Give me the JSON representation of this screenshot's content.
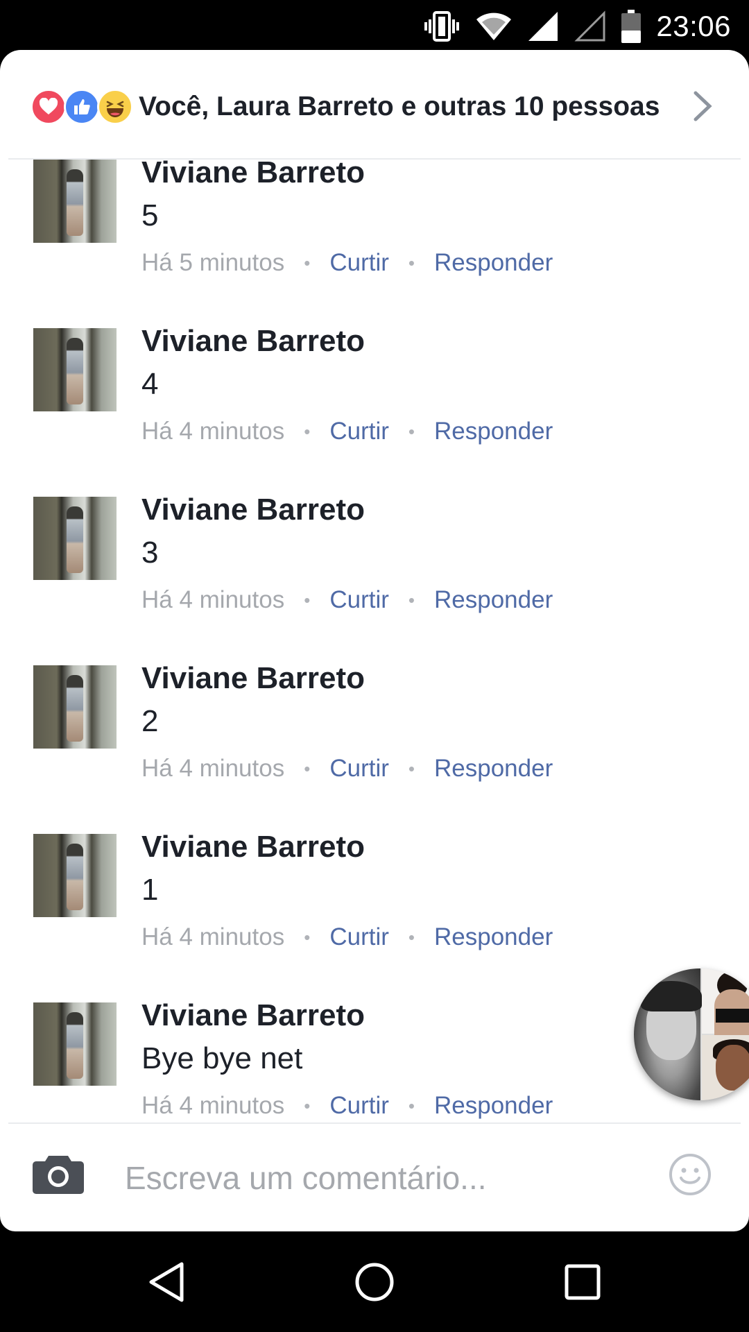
{
  "status_bar": {
    "time": "23:06",
    "icons": [
      "vibrate-icon",
      "wifi-icon",
      "signal-icon",
      "signal-empty-icon",
      "battery-icon"
    ]
  },
  "reactions": {
    "icons": [
      "love-reaction-icon",
      "like-reaction-icon",
      "haha-reaction-icon"
    ],
    "summary": "Você, Laura Barreto e outras 10 pessoas"
  },
  "comments": [
    {
      "author": "Viviane Barreto",
      "text": "5",
      "time": "Há 5 minutos",
      "like": "Curtir",
      "reply": "Responder"
    },
    {
      "author": "Viviane Barreto",
      "text": "4",
      "time": "Há 4 minutos",
      "like": "Curtir",
      "reply": "Responder"
    },
    {
      "author": "Viviane Barreto",
      "text": "3",
      "time": "Há 4 minutos",
      "like": "Curtir",
      "reply": "Responder"
    },
    {
      "author": "Viviane Barreto",
      "text": "2",
      "time": "Há 4 minutos",
      "like": "Curtir",
      "reply": "Responder"
    },
    {
      "author": "Viviane Barreto",
      "text": "1",
      "time": "Há 4 minutos",
      "like": "Curtir",
      "reply": "Responder"
    },
    {
      "author": "Viviane Barreto",
      "text": "Bye bye net",
      "time": "Há 4 minutos",
      "like": "Curtir",
      "reply": "Responder"
    }
  ],
  "composer": {
    "placeholder": "Escreva um comentário...",
    "value": ""
  },
  "colors": {
    "link": "#4f6aa6",
    "text": "#1d2129",
    "muted": "#a5a8ad"
  }
}
